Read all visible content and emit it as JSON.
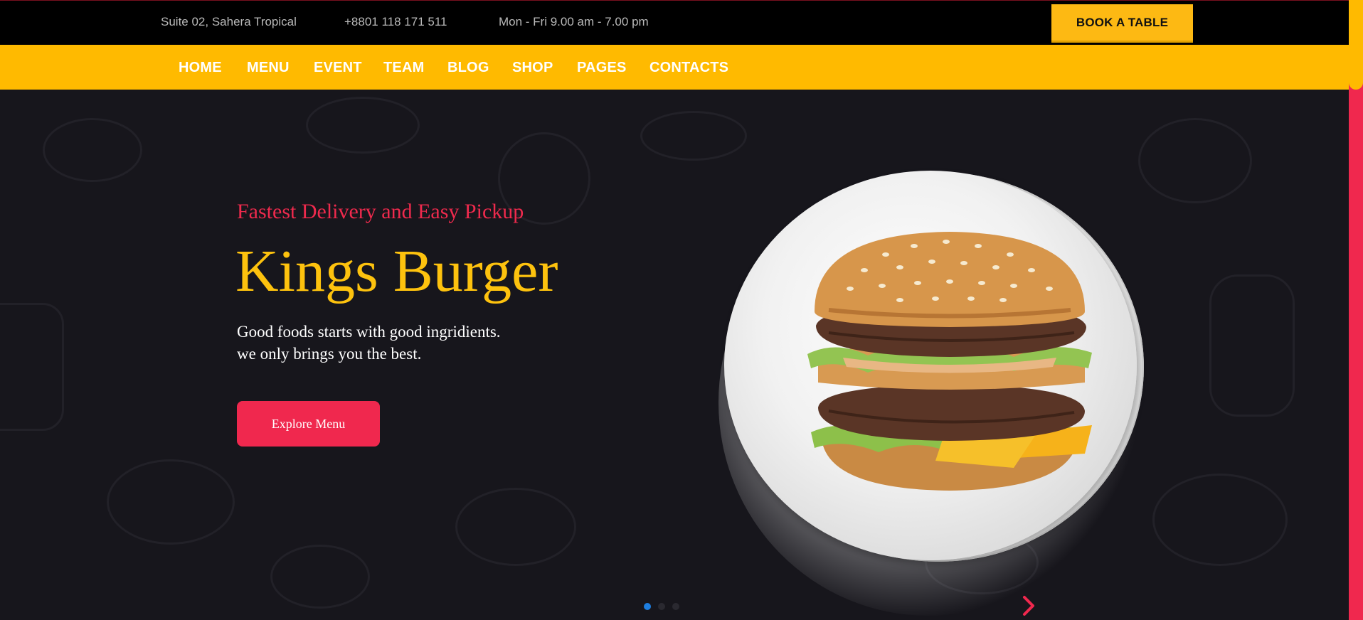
{
  "topbar": {
    "address": "Suite 02, Sahera Tropical",
    "phone": "+8801 118 171 511",
    "hours": "Mon - Fri 9.00 am - 7.00 pm",
    "book_label": "BOOK A TABLE"
  },
  "nav": {
    "items": [
      {
        "label": "HOME"
      },
      {
        "label": "MENU"
      },
      {
        "label": "EVENT"
      },
      {
        "label": "TEAM"
      },
      {
        "label": "BLOG"
      },
      {
        "label": "SHOP"
      },
      {
        "label": "PAGES"
      },
      {
        "label": "CONTACTS"
      }
    ]
  },
  "hero": {
    "subtitle": "Fastest Delivery and Easy Pickup",
    "title": "Kings Burger",
    "desc_line1": "Good foods starts with good ingridients.",
    "desc_line2": "we only brings you the best.",
    "cta_label": "Explore Menu",
    "slide_count": 3,
    "active_slide": 1
  },
  "icons": {
    "next": "chevron-right-icon",
    "dots": "slider-dot-icon"
  },
  "colors": {
    "accent_yellow": "#ffba00",
    "accent_red": "#f0284e",
    "title_yellow": "#fdc20e",
    "background": "#17161c",
    "dot_active": "#1e7ee0"
  }
}
